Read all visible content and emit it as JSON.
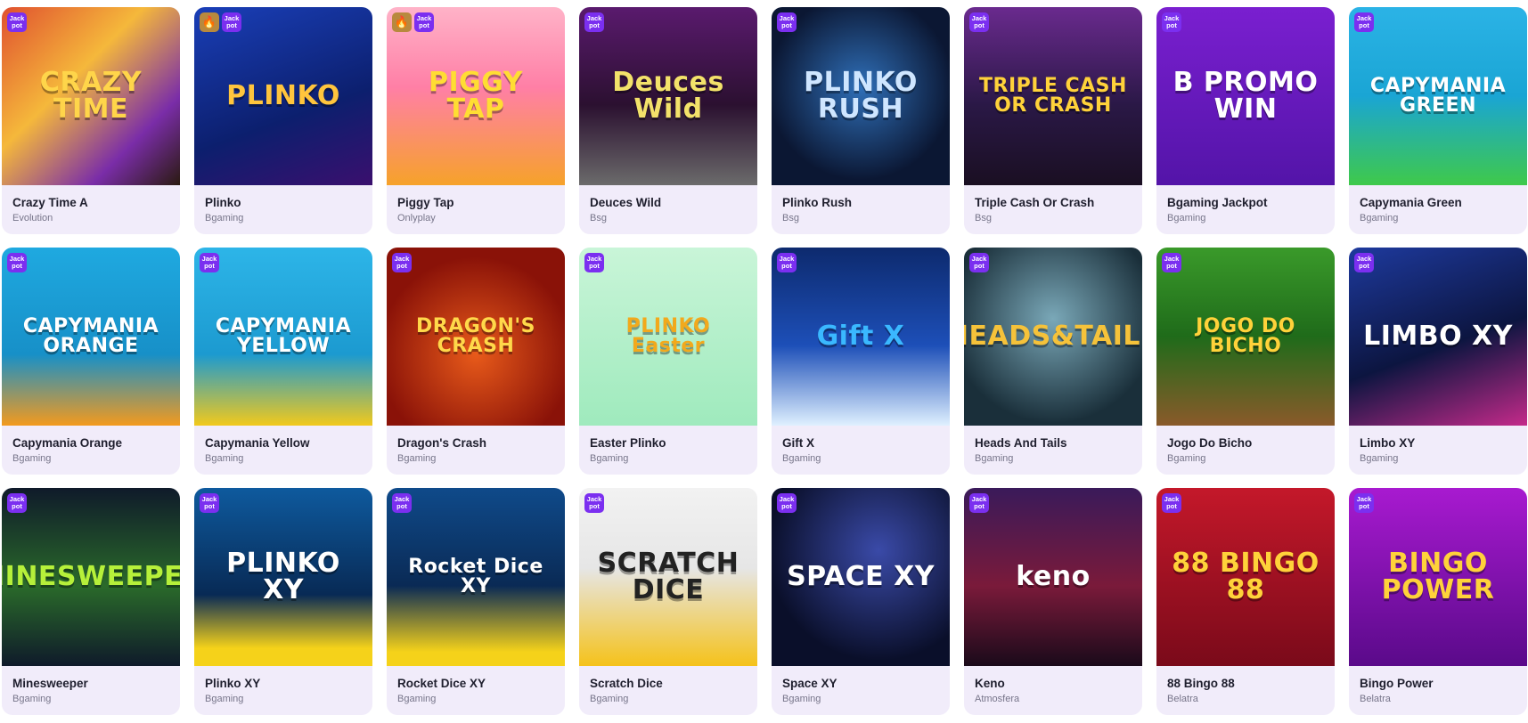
{
  "badges": {
    "jackpot": "Jack\npot",
    "fire_icon": "fire-icon"
  },
  "games": [
    {
      "title": "Crazy Time A",
      "provider": "Evolution",
      "art": "CRAZY TIME",
      "bg": "linear-gradient(135deg,#e0502f,#f5b83b 40%,#7a2da8 75%,#2a1a10)",
      "art_color": "#ffd54a",
      "fire": false
    },
    {
      "title": "Plinko",
      "provider": "Bgaming",
      "art": "PLINKO",
      "bg": "linear-gradient(160deg,#1a3fb8,#0c1f6e 60%,#3a0f6e)",
      "art_color": "#ffc53d",
      "fire": true
    },
    {
      "title": "Piggy Tap",
      "provider": "Onlyplay",
      "art": "PIGGY TAP",
      "bg": "linear-gradient(180deg,#ffb3c8,#ff7fa6 45%,#f6a22a)",
      "art_color": "#ffdd33",
      "fire": true
    },
    {
      "title": "Deuces Wild",
      "provider": "Bsg",
      "art": "Deuces Wild",
      "bg": "linear-gradient(180deg,#5a1a6e,#2b1030 55%,#6b6b6b)",
      "art_color": "#f3e26a",
      "fire": false
    },
    {
      "title": "Plinko Rush",
      "provider": "Bsg",
      "art": "PLINKO RUSH",
      "bg": "radial-gradient(circle at 50% 45%,#2f6fb8,#0b1733 70%)",
      "art_color": "#cfe6ff",
      "fire": false
    },
    {
      "title": "Triple Cash Or Crash",
      "provider": "Bsg",
      "art": "TRIPLE CASH OR CRASH",
      "bg": "linear-gradient(180deg,#6a2a8e,#2a1846 55%,#1a0f22)",
      "art_color": "#ffd23a",
      "fire": false
    },
    {
      "title": "Bgaming Jackpot",
      "provider": "Bgaming",
      "art": "B PROMO WIN",
      "bg": "linear-gradient(180deg,#7a1fd0,#5314a8)",
      "art_color": "#ffffff",
      "fire": false
    },
    {
      "title": "Capymania Green",
      "provider": "Bgaming",
      "art": "CAPYMANIA GREEN",
      "bg": "linear-gradient(180deg,#2bb3e6,#1aa5d4 50%,#3fc94a)",
      "art_color": "#ffffff",
      "fire": false
    },
    {
      "title": "Capymania Orange",
      "provider": "Bgaming",
      "art": "CAPYMANIA ORANGE",
      "bg": "linear-gradient(180deg,#1fa9e0,#1790c8 60%,#f39a1e)",
      "art_color": "#ffffff",
      "fire": false
    },
    {
      "title": "Capymania Yellow",
      "provider": "Bgaming",
      "art": "CAPYMANIA YELLOW",
      "bg": "linear-gradient(180deg,#2db5e8,#1c9ad0 60%,#f2c91c)",
      "art_color": "#ffffff",
      "fire": false
    },
    {
      "title": "Dragon's Crash",
      "provider": "Bgaming",
      "art": "DRAGON'S CRASH",
      "bg": "radial-gradient(circle at 50% 60%,#e85a1a,#8a1208 70%)",
      "art_color": "#ffd84a",
      "fire": false
    },
    {
      "title": "Easter Plinko",
      "provider": "Bgaming",
      "art": "PLINKO Easter",
      "bg": "linear-gradient(180deg,#c9f5d8,#9feabd)",
      "art_color": "#f2a91c",
      "fire": false
    },
    {
      "title": "Gift X",
      "provider": "Bgaming",
      "art": "Gift X",
      "bg": "linear-gradient(180deg,#0d2a6e,#1d4fb8 55%,#dff0ff)",
      "art_color": "#3ab8ff",
      "fire": false
    },
    {
      "title": "Heads And Tails",
      "provider": "Bgaming",
      "art": "HEADS&TAILS",
      "bg": "radial-gradient(circle at 50% 40%,#7aa8b8,#1a2f3a 75%)",
      "art_color": "#f5c23a",
      "fire": false
    },
    {
      "title": "Jogo Do Bicho",
      "provider": "Bgaming",
      "art": "JOGO DO BICHO",
      "bg": "linear-gradient(180deg,#3a9a2a,#1f6b1a 50%,#8a5a2a)",
      "art_color": "#ffd23a",
      "fire": false
    },
    {
      "title": "Limbo XY",
      "provider": "Bgaming",
      "art": "LIMBO XY",
      "bg": "linear-gradient(160deg,#1e3a9e,#0c1540 55%,#c42a8a)",
      "art_color": "#ffffff",
      "fire": false
    },
    {
      "title": "Minesweeper",
      "provider": "Bgaming",
      "art": "MINESWEEPER",
      "bg": "linear-gradient(180deg,#0f1a2a,#2a6a2a 55%,#0f1a2a)",
      "art_color": "#b6f03a",
      "fire": false
    },
    {
      "title": "Plinko XY",
      "provider": "Bgaming",
      "art": "PLINKO XY",
      "bg": "linear-gradient(180deg,#0e5a9e,#082a55 60%,#f5d21a 90%)",
      "art_color": "#ffffff",
      "fire": false
    },
    {
      "title": "Rocket Dice XY",
      "provider": "Bgaming",
      "art": "Rocket Dice XY",
      "bg": "linear-gradient(180deg,#0f4a8a,#0a2a55 55%,#f5d21a 92%)",
      "art_color": "#ffffff",
      "fire": false
    },
    {
      "title": "Scratch Dice",
      "provider": "Bgaming",
      "art": "SCRATCH DICE",
      "bg": "linear-gradient(180deg,#f2f2f2,#e6e6e6 45%,#f5c21a)",
      "art_color": "#222222",
      "fire": false
    },
    {
      "title": "Space XY",
      "provider": "Bgaming",
      "art": "SPACE XY",
      "bg": "radial-gradient(circle at 60% 35%,#3a4aa8,#0a0f2a 70%)",
      "art_color": "#ffffff",
      "fire": false
    },
    {
      "title": "Keno",
      "provider": "Atmosfera",
      "art": "keno",
      "bg": "linear-gradient(180deg,#3a1a5a,#7a1a3a 55%,#1a0a1a)",
      "art_color": "#ffffff",
      "fire": false
    },
    {
      "title": "88 Bingo 88",
      "provider": "Belatra",
      "art": "88 BINGO 88",
      "bg": "linear-gradient(180deg,#c4182a,#7a0a1a)",
      "art_color": "#ffd23a",
      "fire": false
    },
    {
      "title": "Bingo Power",
      "provider": "Belatra",
      "art": "BINGO POWER",
      "bg": "linear-gradient(180deg,#a81ad0,#5a0a8a)",
      "art_color": "#ffd23a",
      "fire": false
    }
  ]
}
